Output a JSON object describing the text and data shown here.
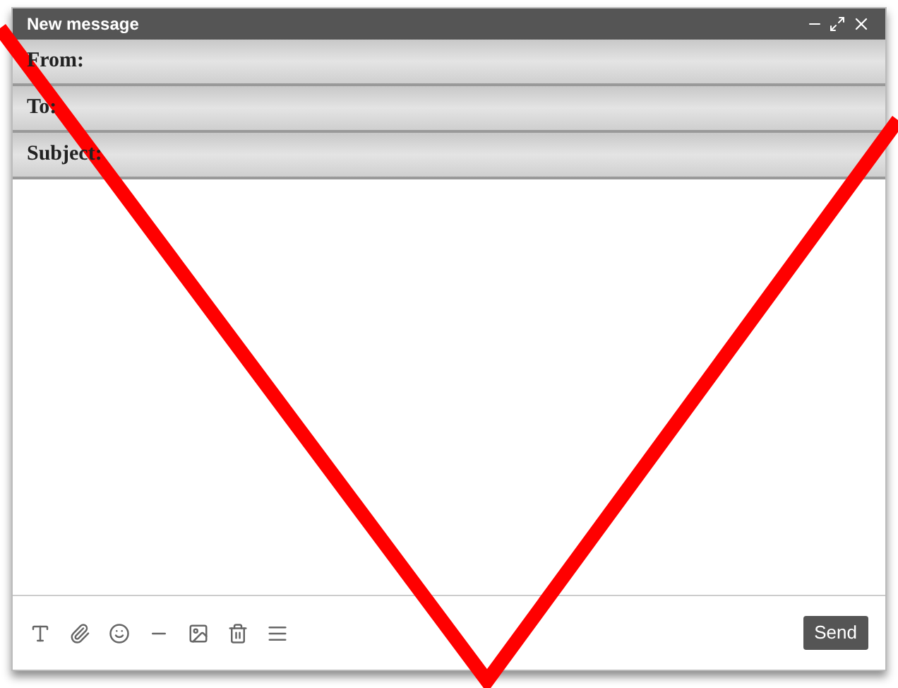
{
  "window": {
    "title": "New message"
  },
  "fields": [
    {
      "label": "From:"
    },
    {
      "label": "To:"
    },
    {
      "label": "Subject:"
    }
  ],
  "send_button": {
    "label": "Send"
  }
}
